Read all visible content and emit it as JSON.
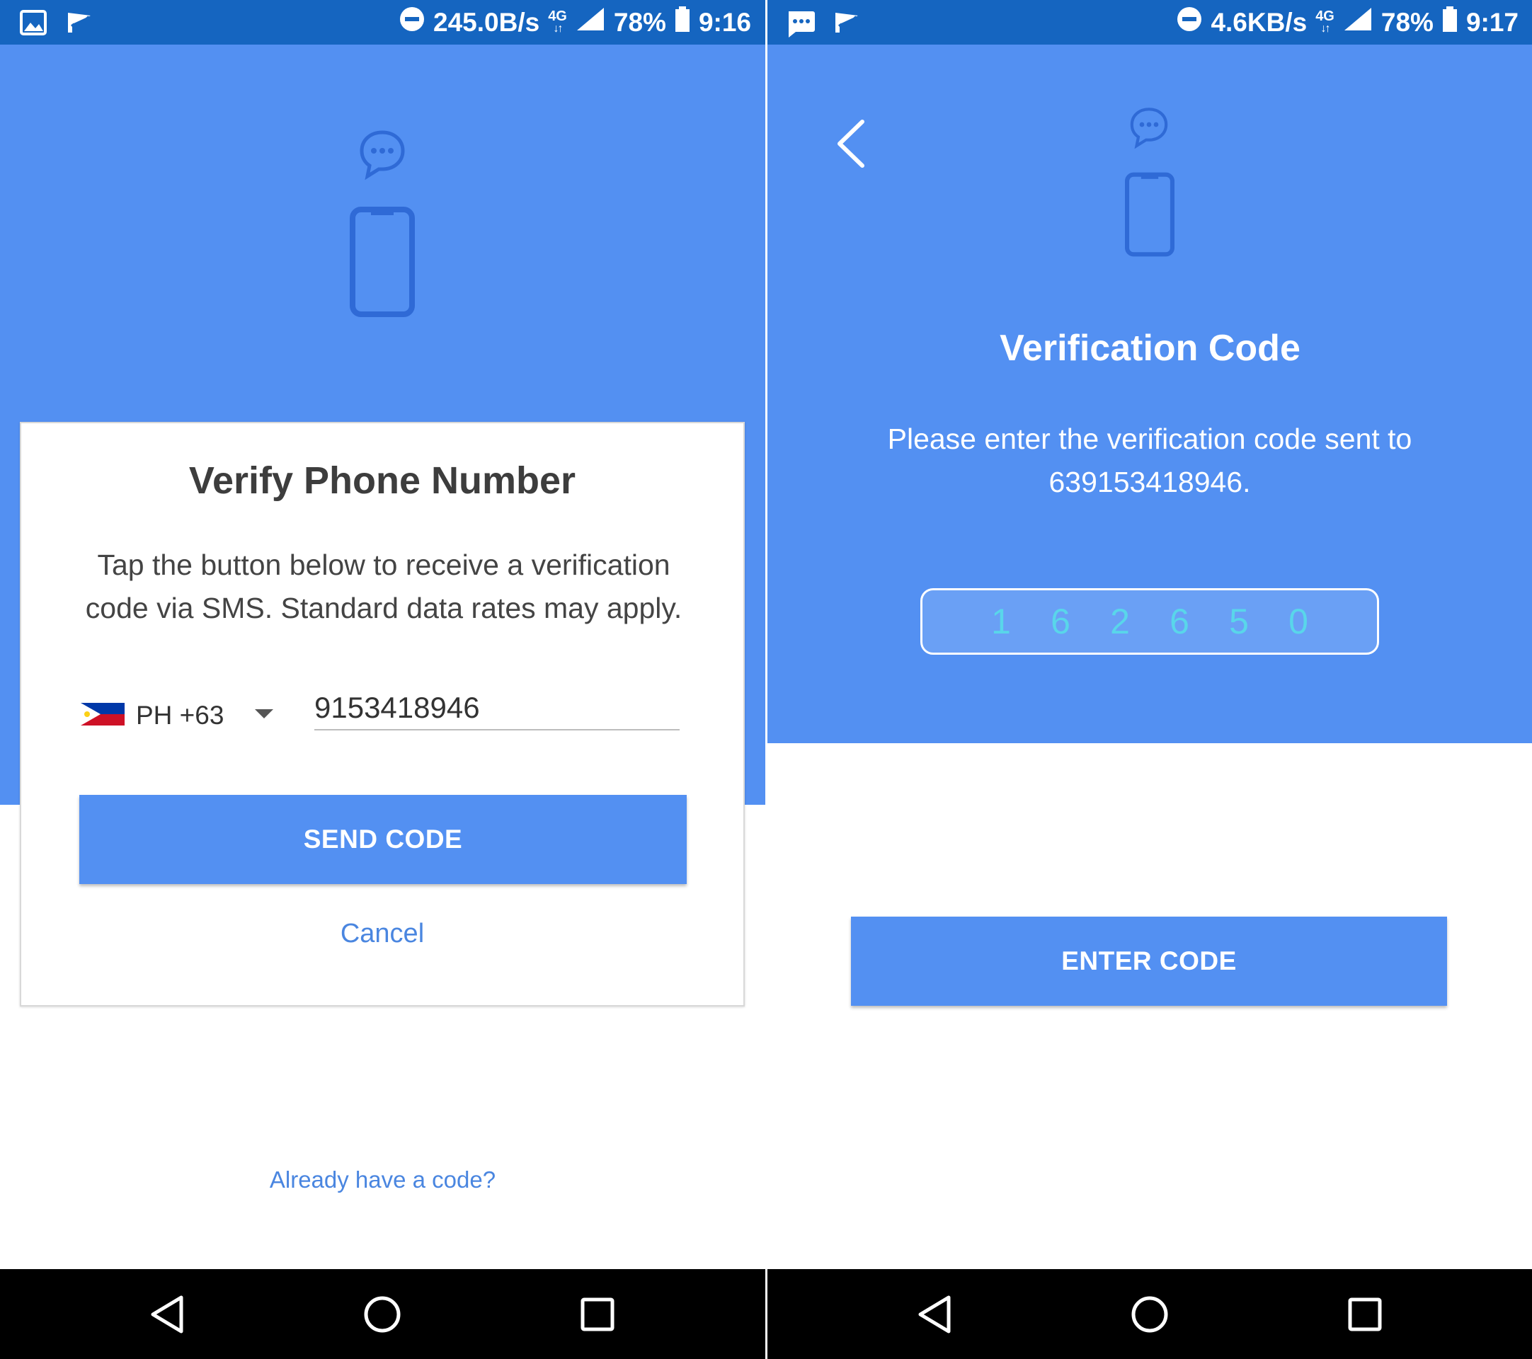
{
  "left_screen": {
    "status_bar": {
      "speed": "245.0B/s",
      "network": "4G",
      "battery": "78%",
      "time": "9:16",
      "left_icons": [
        "image-icon",
        "check-flag-icon"
      ]
    },
    "dialog": {
      "title": "Verify Phone Number",
      "body": "Tap the button below to receive a verification code via SMS. Standard data rates may apply.",
      "country_code": "PH +63",
      "phone_number": "9153418946",
      "send_button": "SEND CODE",
      "cancel": "Cancel"
    },
    "already_have_code": "Already have a code?"
  },
  "right_screen": {
    "status_bar": {
      "speed": "4.6KB/s",
      "network": "4G",
      "battery": "78%",
      "time": "9:17",
      "left_icons": [
        "message-icon",
        "check-flag-icon"
      ]
    },
    "title": "Verification Code",
    "body": "Please enter the verification code sent to 639153418946.",
    "code_digits": [
      "1",
      "6",
      "2",
      "6",
      "5",
      "0"
    ],
    "enter_button": "ENTER CODE"
  },
  "colors": {
    "status_bar": "#1565c0",
    "primary_blue": "#5390f2",
    "link_blue": "#4a86e0",
    "code_digit": "#59d6ea",
    "nav_bar": "#000000"
  }
}
